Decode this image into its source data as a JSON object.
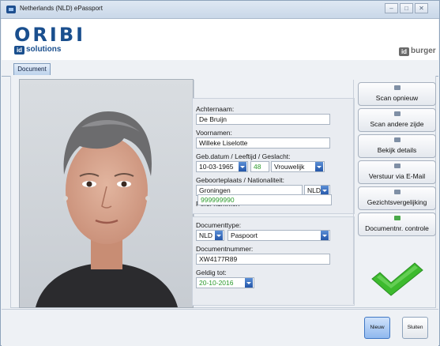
{
  "window": {
    "title": "Netherlands (NLD) ePassport",
    "controls": [
      "minimize",
      "maximize",
      "close"
    ]
  },
  "header": {
    "logo_main": "ORIBI",
    "logo_id": "id",
    "logo_sub": "solutions",
    "brand_id": "id",
    "brand_name": "burger"
  },
  "tabs": [
    {
      "label": "Document"
    }
  ],
  "form": {
    "achternaam_label": "Achternaam:",
    "achternaam": "De Bruijn",
    "voornamen_label": "Voornamen:",
    "voornamen": "Willeke Liselotte",
    "geb_label": "Geb.datum / Leeftijd / Geslacht:",
    "geb_datum": "10-03-1965",
    "leeftijd": "48",
    "geslacht": "Vrouwelijk",
    "geboorteplaats_label": "Geboorteplaats / Nationaliteit:",
    "geboorteplaats": "Groningen",
    "nationaliteit": "NLD",
    "pers_label": "Pers. nummer:",
    "pers_nummer": "999999990",
    "doctype_label": "Documenttype:",
    "doctype_country": "NLD",
    "doctype": "Paspoort",
    "docnr_label": "Documentnummer:",
    "docnr": "XW4177R89",
    "geldig_label": "Geldig tot:",
    "geldig_tot": "20-10-2016"
  },
  "actions": [
    {
      "label": "Scan opnieuw",
      "icon": "scan-icon"
    },
    {
      "label": "Scan andere zijde",
      "icon": "flip-scan-icon"
    },
    {
      "label": "Bekijk details",
      "icon": "details-icon"
    },
    {
      "label": "Verstuur via E-Mail",
      "icon": "email-icon"
    },
    {
      "label": "Gezichtsvergelijking",
      "icon": "face-compare-icon"
    },
    {
      "label": "Documentnr. controle",
      "icon": "check-doc-icon"
    }
  ],
  "status": {
    "icon": "checkmark-icon",
    "color": "#3dba2e"
  },
  "footer": {
    "new_label": "Nieuw",
    "close_label": "Sluiten"
  }
}
